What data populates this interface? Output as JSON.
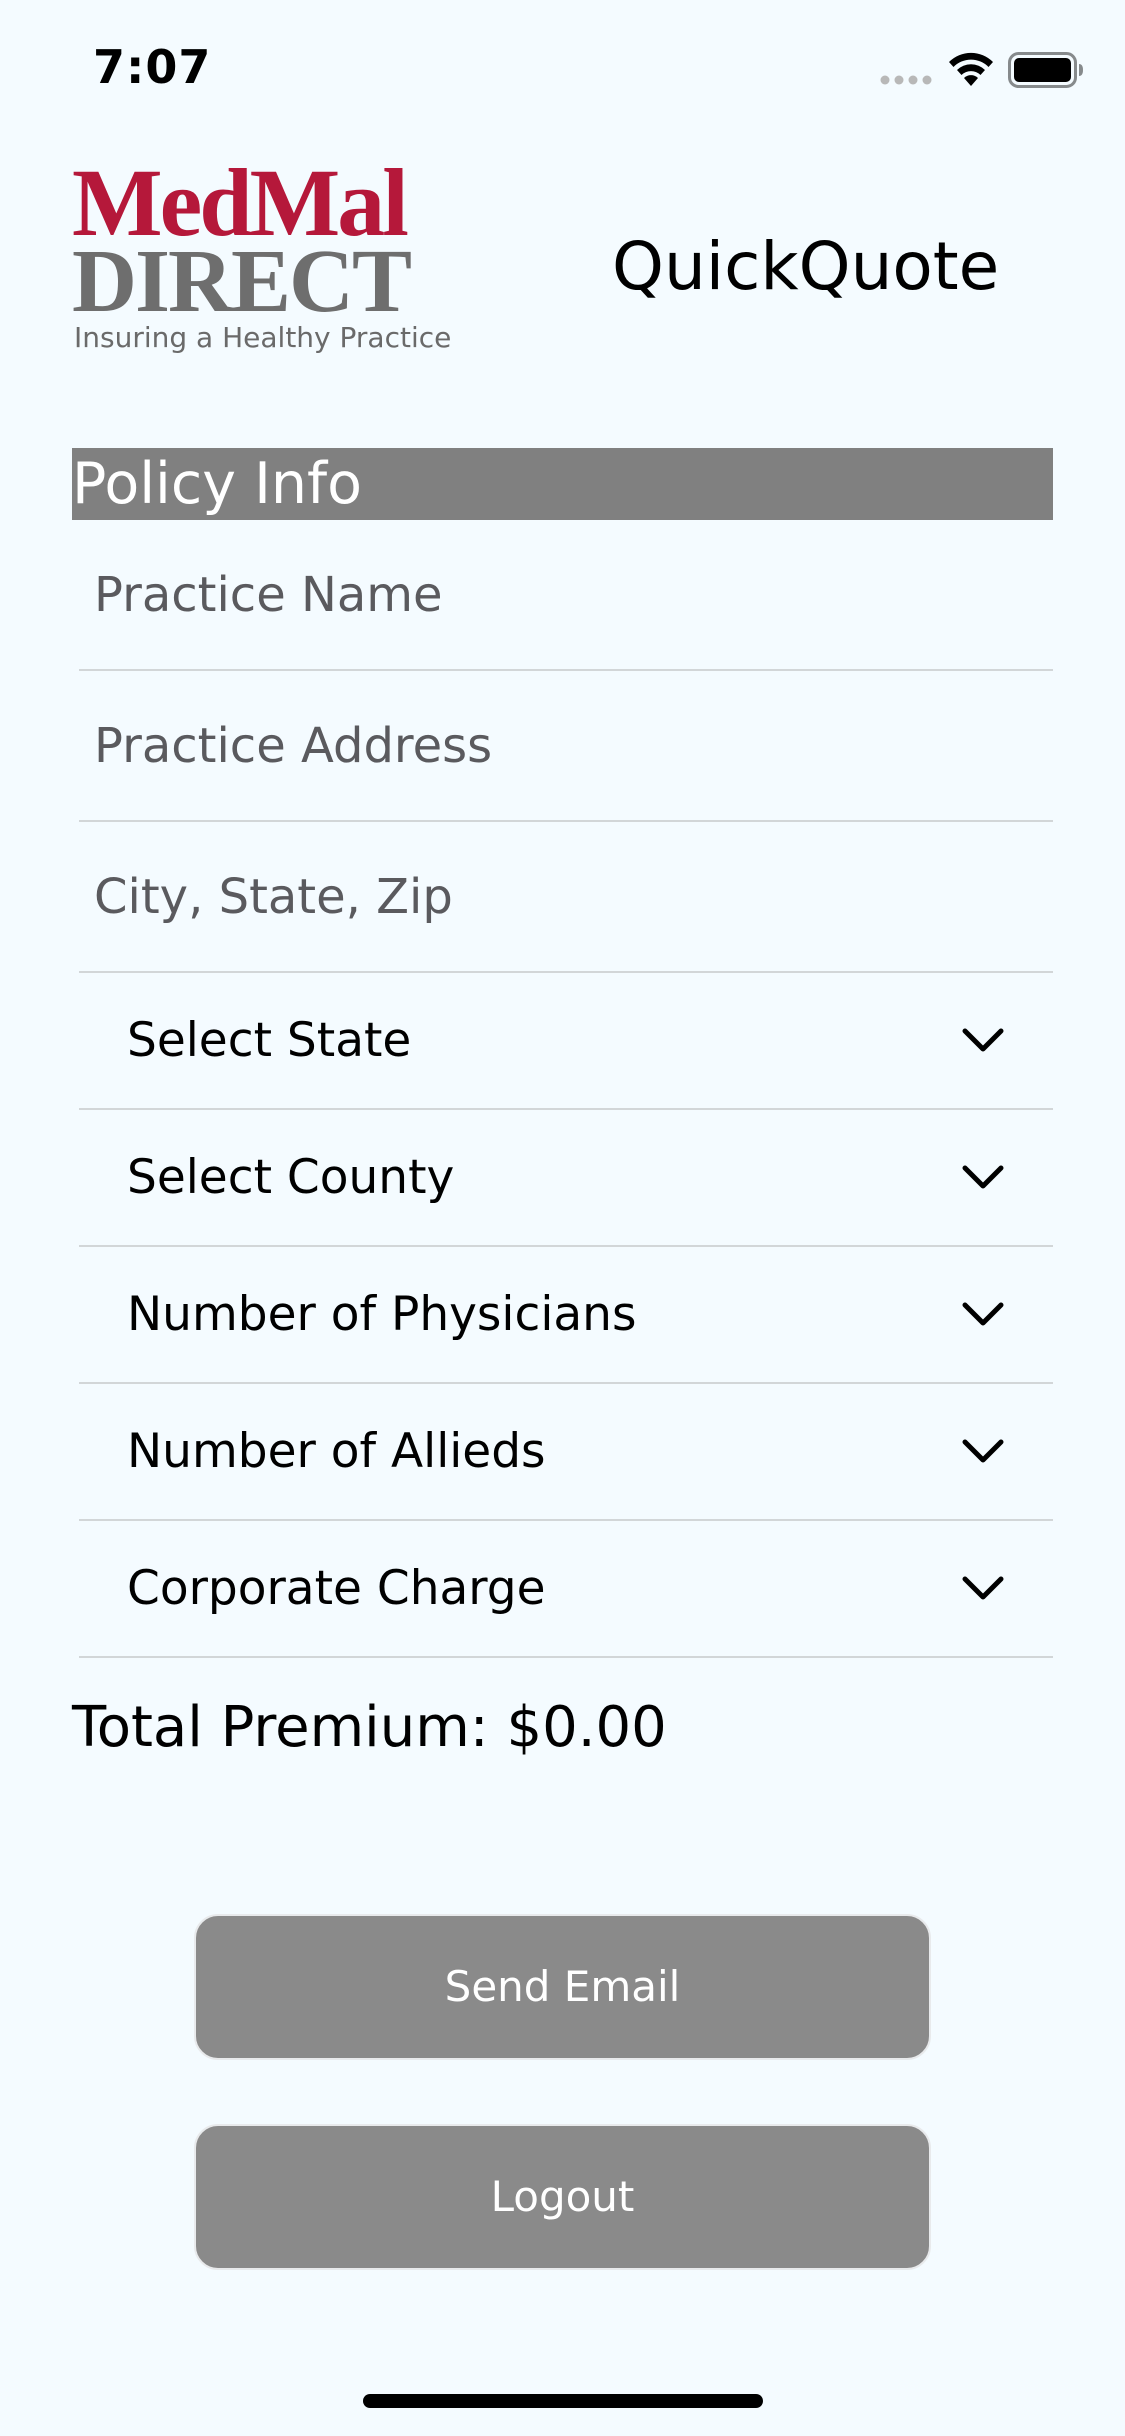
{
  "status_bar": {
    "time": "7:07",
    "icons": [
      "signal-icon",
      "wifi-icon",
      "battery-icon"
    ]
  },
  "header": {
    "logo": {
      "line1": "MedMal",
      "line2": "DIRECT",
      "tagline": "Insuring a Healthy Practice",
      "brand_color": "#b5183a",
      "secondary_color": "#6e6e6e"
    },
    "title": "QuickQuote"
  },
  "policy_info": {
    "section_title": "Policy Info",
    "section_color": "#808080",
    "fields": {
      "practice_name": {
        "value": "",
        "placeholder": "Practice Name"
      },
      "practice_address": {
        "value": "",
        "placeholder": "Practice Address"
      },
      "city_state_zip": {
        "value": "",
        "placeholder": "City, State, Zip"
      }
    },
    "selects": [
      {
        "label": "Select State",
        "icon": "chevron-down-icon"
      },
      {
        "label": "Select County",
        "icon": "chevron-down-icon"
      },
      {
        "label": "Number of Physicians",
        "icon": "chevron-down-icon"
      },
      {
        "label": "Number of Allieds",
        "icon": "chevron-down-icon"
      },
      {
        "label": "Corporate Charge",
        "icon": "chevron-down-icon"
      }
    ]
  },
  "total_premium": "Total Premium: $0.00",
  "buttons": {
    "send_email": "Send Email",
    "logout": "Logout",
    "color": "#8a8a8a"
  },
  "colors": {
    "background": "#f4fbff",
    "divider": "#d2d6d8"
  }
}
